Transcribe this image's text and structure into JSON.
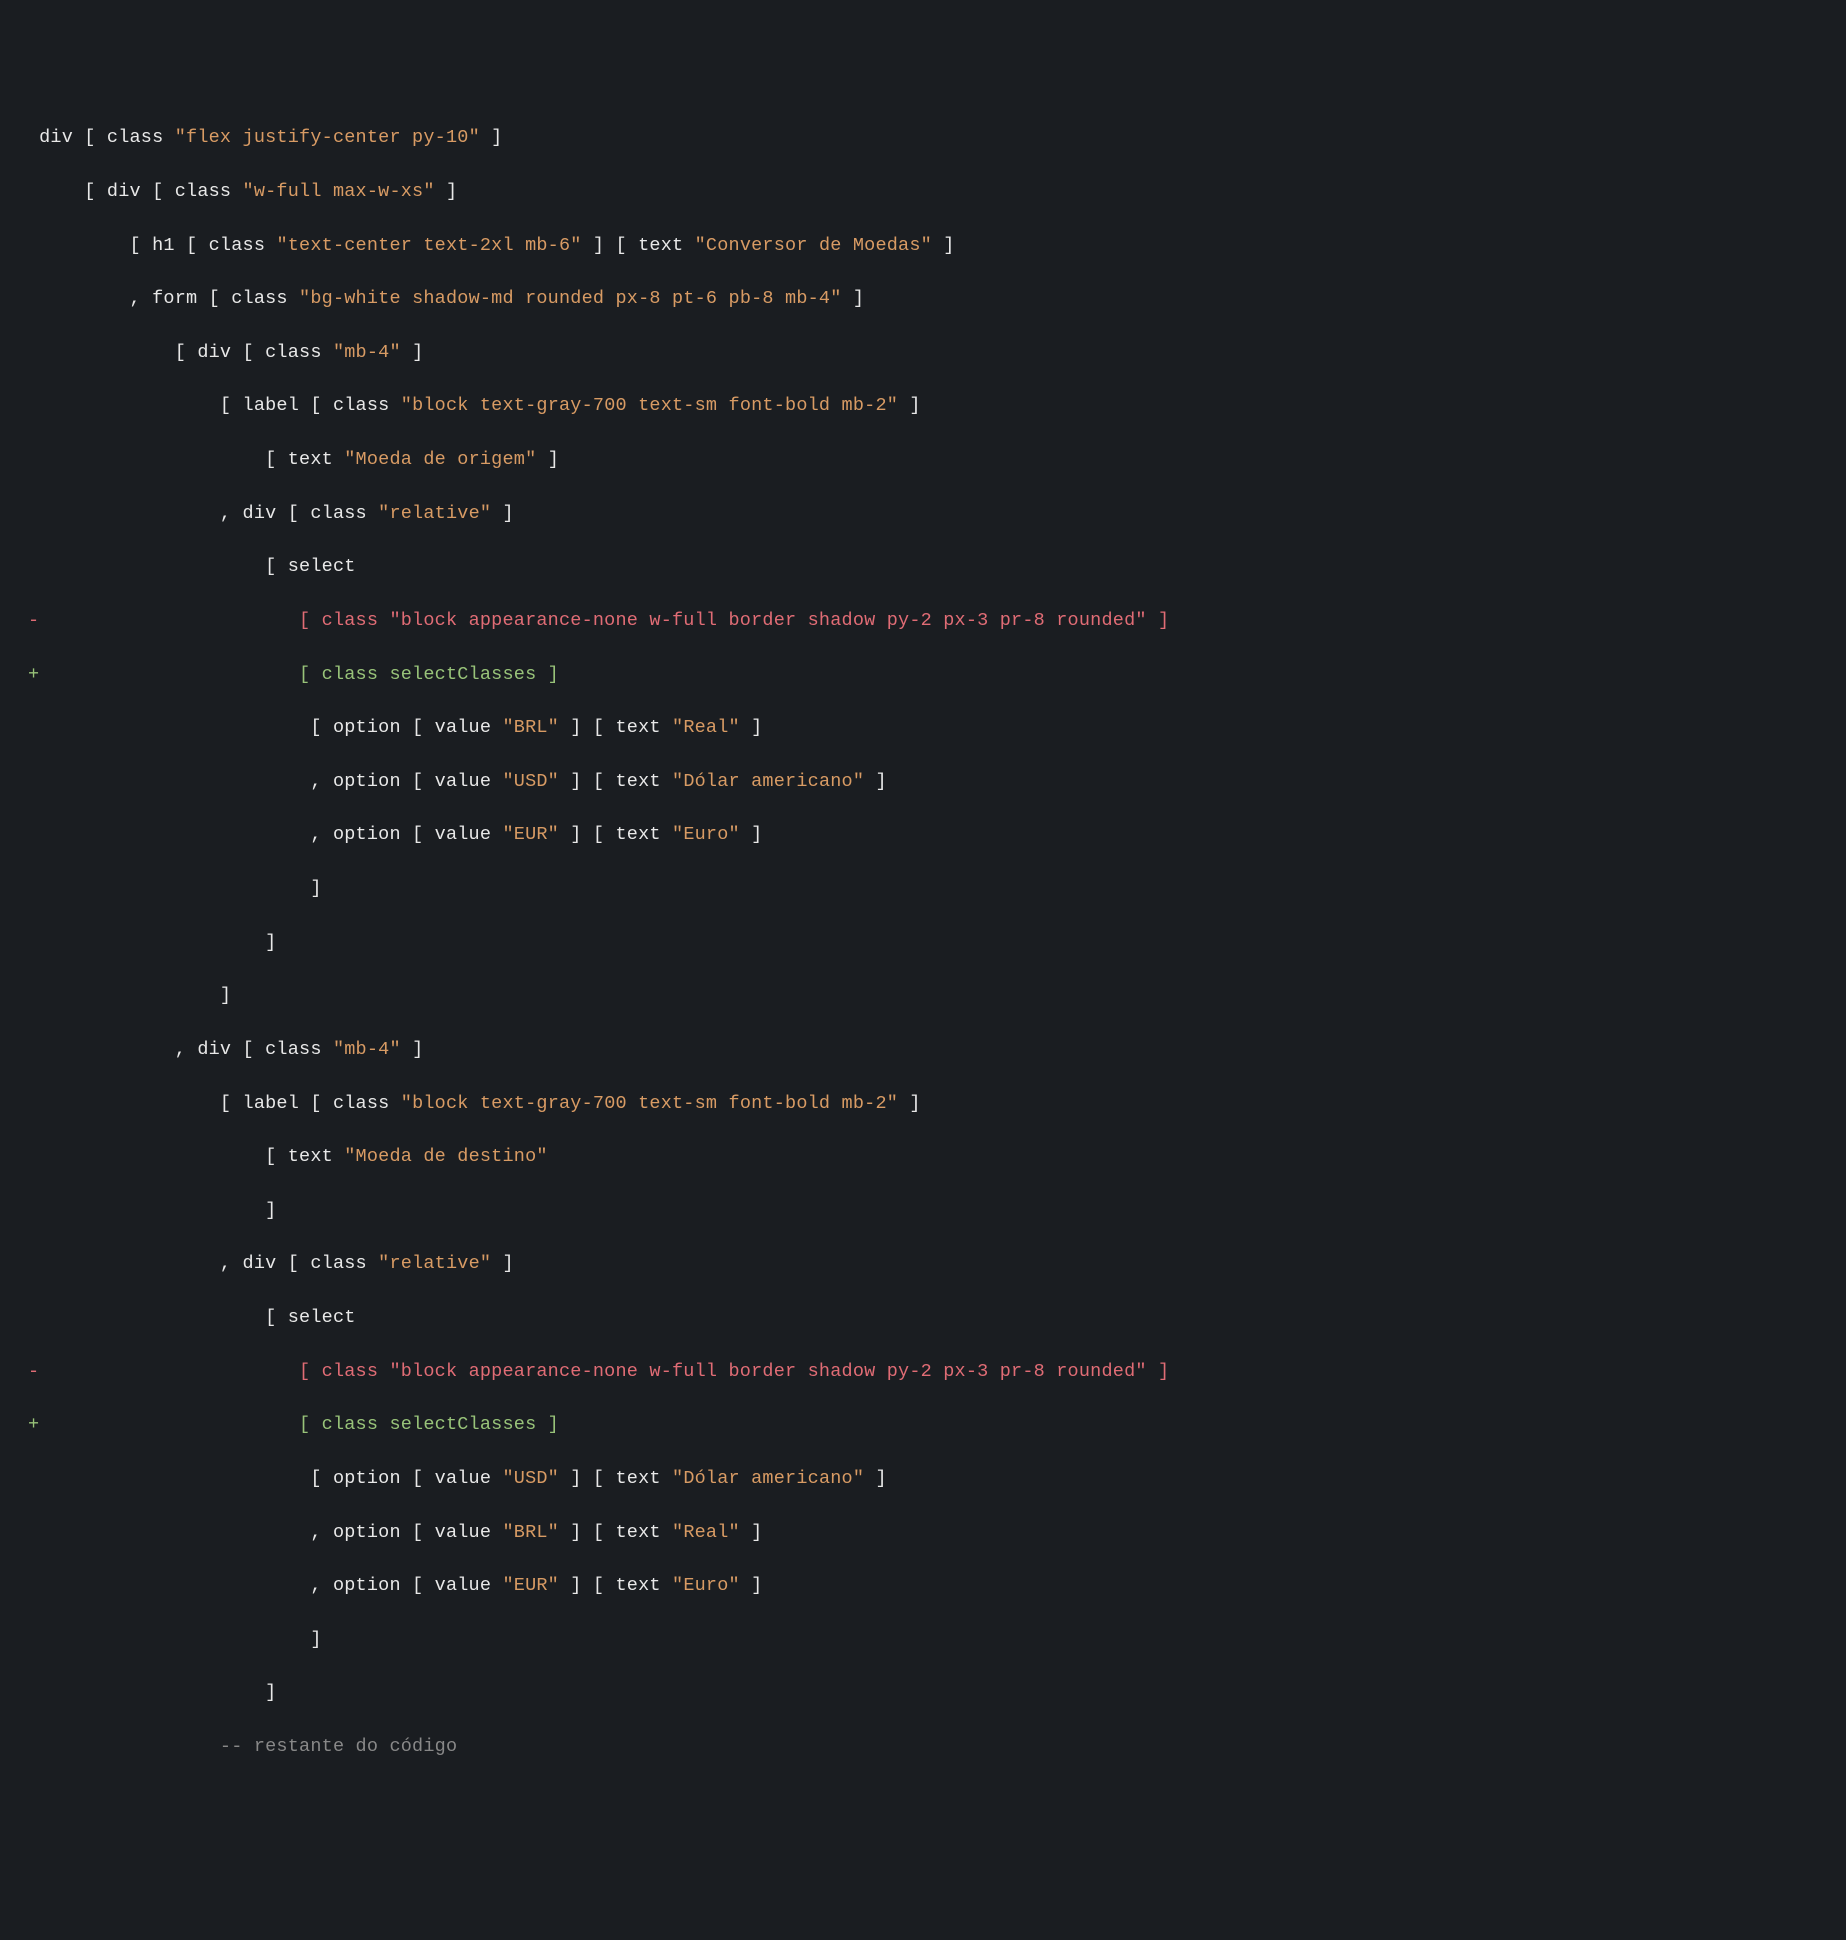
{
  "lines": [
    {
      "marker": "",
      "markerClass": "",
      "segments": [
        {
          "t": "div [ class ",
          "c": "t-default"
        },
        {
          "t": "\"flex justify-center py-10\"",
          "c": "t-string"
        },
        {
          "t": " ]",
          "c": "t-default"
        }
      ]
    },
    {
      "marker": "",
      "markerClass": "",
      "segments": [
        {
          "t": "    [ div [ class ",
          "c": "t-default"
        },
        {
          "t": "\"w-full max-w-xs\"",
          "c": "t-string"
        },
        {
          "t": " ]",
          "c": "t-default"
        }
      ]
    },
    {
      "marker": "",
      "markerClass": "",
      "segments": [
        {
          "t": "        [ h1 [ class ",
          "c": "t-default"
        },
        {
          "t": "\"text-center text-2xl mb-6\"",
          "c": "t-string"
        },
        {
          "t": " ] [ text ",
          "c": "t-default"
        },
        {
          "t": "\"Conversor de Moedas\"",
          "c": "t-string"
        },
        {
          "t": " ]",
          "c": "t-default"
        }
      ]
    },
    {
      "marker": "",
      "markerClass": "",
      "segments": [
        {
          "t": "        , form [ class ",
          "c": "t-default"
        },
        {
          "t": "\"bg-white shadow-md rounded px-8 pt-6 pb-8 mb-4\"",
          "c": "t-string"
        },
        {
          "t": " ]",
          "c": "t-default"
        }
      ]
    },
    {
      "marker": "",
      "markerClass": "",
      "segments": [
        {
          "t": "            [ div [ class ",
          "c": "t-default"
        },
        {
          "t": "\"mb-4\"",
          "c": "t-string"
        },
        {
          "t": " ]",
          "c": "t-default"
        }
      ]
    },
    {
      "marker": "",
      "markerClass": "",
      "segments": [
        {
          "t": "                [ label [ class ",
          "c": "t-default"
        },
        {
          "t": "\"block text-gray-700 text-sm font-bold mb-2\"",
          "c": "t-string"
        },
        {
          "t": " ]",
          "c": "t-default"
        }
      ]
    },
    {
      "marker": "",
      "markerClass": "",
      "segments": [
        {
          "t": "                    [ text ",
          "c": "t-default"
        },
        {
          "t": "\"Moeda de origem\"",
          "c": "t-string"
        },
        {
          "t": " ]",
          "c": "t-default"
        }
      ]
    },
    {
      "marker": "",
      "markerClass": "",
      "segments": [
        {
          "t": "                , div [ class ",
          "c": "t-default"
        },
        {
          "t": "\"relative\"",
          "c": "t-string"
        },
        {
          "t": " ]",
          "c": "t-default"
        }
      ]
    },
    {
      "marker": "",
      "markerClass": "",
      "segments": [
        {
          "t": "                    [ select",
          "c": "t-default"
        }
      ]
    },
    {
      "marker": "-",
      "markerClass": "t-removed",
      "segments": [
        {
          "t": "                       [ class ",
          "c": "t-removed"
        },
        {
          "t": "\"block appearance-none w-full border shadow py-2 px-3 pr-8 rounded\"",
          "c": "t-removed"
        },
        {
          "t": " ]",
          "c": "t-removed"
        }
      ]
    },
    {
      "marker": "+",
      "markerClass": "t-added",
      "segments": [
        {
          "t": "                       [ class selectClasses ]",
          "c": "t-added"
        }
      ]
    },
    {
      "marker": "",
      "markerClass": "",
      "segments": [
        {
          "t": "                        [ option [ value ",
          "c": "t-default"
        },
        {
          "t": "\"BRL\"",
          "c": "t-string"
        },
        {
          "t": " ] [ text ",
          "c": "t-default"
        },
        {
          "t": "\"Real\"",
          "c": "t-string"
        },
        {
          "t": " ]",
          "c": "t-default"
        }
      ]
    },
    {
      "marker": "",
      "markerClass": "",
      "segments": [
        {
          "t": "                        , option [ value ",
          "c": "t-default"
        },
        {
          "t": "\"USD\"",
          "c": "t-string"
        },
        {
          "t": " ] [ text ",
          "c": "t-default"
        },
        {
          "t": "\"Dólar americano\"",
          "c": "t-string"
        },
        {
          "t": " ]",
          "c": "t-default"
        }
      ]
    },
    {
      "marker": "",
      "markerClass": "",
      "segments": [
        {
          "t": "                        , option [ value ",
          "c": "t-default"
        },
        {
          "t": "\"EUR\"",
          "c": "t-string"
        },
        {
          "t": " ] [ text ",
          "c": "t-default"
        },
        {
          "t": "\"Euro\"",
          "c": "t-string"
        },
        {
          "t": " ]",
          "c": "t-default"
        }
      ]
    },
    {
      "marker": "",
      "markerClass": "",
      "segments": [
        {
          "t": "                        ]",
          "c": "t-default"
        }
      ]
    },
    {
      "marker": "",
      "markerClass": "",
      "segments": [
        {
          "t": "                    ]",
          "c": "t-default"
        }
      ]
    },
    {
      "marker": "",
      "markerClass": "",
      "segments": [
        {
          "t": "                ]",
          "c": "t-default"
        }
      ]
    },
    {
      "marker": "",
      "markerClass": "",
      "segments": [
        {
          "t": "            , div [ class ",
          "c": "t-default"
        },
        {
          "t": "\"mb-4\"",
          "c": "t-string"
        },
        {
          "t": " ]",
          "c": "t-default"
        }
      ]
    },
    {
      "marker": "",
      "markerClass": "",
      "segments": [
        {
          "t": "                [ label [ class ",
          "c": "t-default"
        },
        {
          "t": "\"block text-gray-700 text-sm font-bold mb-2\"",
          "c": "t-string"
        },
        {
          "t": " ]",
          "c": "t-default"
        }
      ]
    },
    {
      "marker": "",
      "markerClass": "",
      "segments": [
        {
          "t": "                    [ text ",
          "c": "t-default"
        },
        {
          "t": "\"Moeda de destino\"",
          "c": "t-string"
        }
      ]
    },
    {
      "marker": "",
      "markerClass": "",
      "segments": [
        {
          "t": "                    ]",
          "c": "t-default"
        }
      ]
    },
    {
      "marker": "",
      "markerClass": "",
      "segments": [
        {
          "t": "                , div [ class ",
          "c": "t-default"
        },
        {
          "t": "\"relative\"",
          "c": "t-string"
        },
        {
          "t": " ]",
          "c": "t-default"
        }
      ]
    },
    {
      "marker": "",
      "markerClass": "",
      "segments": [
        {
          "t": "                    [ select",
          "c": "t-default"
        }
      ]
    },
    {
      "marker": "-",
      "markerClass": "t-removed",
      "segments": [
        {
          "t": "                       [ class ",
          "c": "t-removed"
        },
        {
          "t": "\"block appearance-none w-full border shadow py-2 px-3 pr-8 rounded\"",
          "c": "t-removed"
        },
        {
          "t": " ]",
          "c": "t-removed"
        }
      ]
    },
    {
      "marker": "+",
      "markerClass": "t-added",
      "segments": [
        {
          "t": "                       [ class selectClasses ]",
          "c": "t-added"
        }
      ]
    },
    {
      "marker": "",
      "markerClass": "",
      "segments": [
        {
          "t": "                        [ option [ value ",
          "c": "t-default"
        },
        {
          "t": "\"USD\"",
          "c": "t-string"
        },
        {
          "t": " ] [ text ",
          "c": "t-default"
        },
        {
          "t": "\"Dólar americano\"",
          "c": "t-string"
        },
        {
          "t": " ]",
          "c": "t-default"
        }
      ]
    },
    {
      "marker": "",
      "markerClass": "",
      "segments": [
        {
          "t": "                        , option [ value ",
          "c": "t-default"
        },
        {
          "t": "\"BRL\"",
          "c": "t-string"
        },
        {
          "t": " ] [ text ",
          "c": "t-default"
        },
        {
          "t": "\"Real\"",
          "c": "t-string"
        },
        {
          "t": " ]",
          "c": "t-default"
        }
      ]
    },
    {
      "marker": "",
      "markerClass": "",
      "segments": [
        {
          "t": "                        , option [ value ",
          "c": "t-default"
        },
        {
          "t": "\"EUR\"",
          "c": "t-string"
        },
        {
          "t": " ] [ text ",
          "c": "t-default"
        },
        {
          "t": "\"Euro\"",
          "c": "t-string"
        },
        {
          "t": " ]",
          "c": "t-default"
        }
      ]
    },
    {
      "marker": "",
      "markerClass": "",
      "segments": [
        {
          "t": "                        ]",
          "c": "t-default"
        }
      ]
    },
    {
      "marker": "",
      "markerClass": "",
      "segments": [
        {
          "t": "                    ]",
          "c": "t-default"
        }
      ]
    },
    {
      "marker": "",
      "markerClass": "",
      "segments": [
        {
          "t": "                -- restante do código",
          "c": "t-comment"
        }
      ]
    }
  ]
}
